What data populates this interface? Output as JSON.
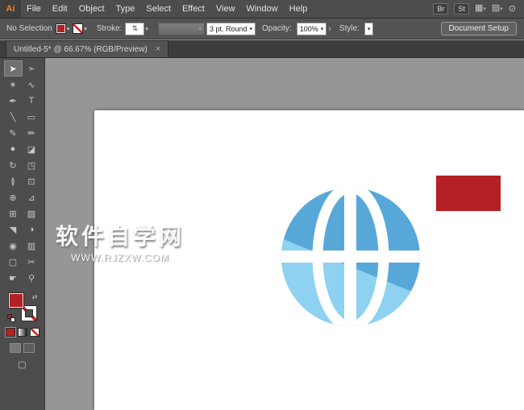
{
  "app": {
    "logo": "Ai"
  },
  "menu_bar": {
    "items": [
      "File",
      "Edit",
      "Object",
      "Type",
      "Select",
      "Effect",
      "View",
      "Window",
      "Help"
    ],
    "right": {
      "bridge": "Br",
      "stock": "St"
    }
  },
  "icons": {
    "dropdown": "▾",
    "spinner": "⇅",
    "chevron_right": "›",
    "arrange_documents": "▦",
    "workspace": "▤",
    "power": "⊙",
    "swap": "⇄",
    "close": "×",
    "screen_mode": "▢"
  },
  "control_bar": {
    "selection_label": "No Selection",
    "stroke_label": "Stroke:",
    "brush_value": "3 pt. Round",
    "opacity_label": "Opacity:",
    "opacity_value": "100%",
    "style_label": "Style:",
    "document_setup_label": "Document Setup"
  },
  "tab": {
    "title": "Untitled-5* @ 66.67% (RGB/Preview)"
  },
  "toolbar": {
    "tools": [
      {
        "name": "selection-tool",
        "glyph": "➤"
      },
      {
        "name": "direct-selection-tool",
        "glyph": "➣"
      },
      {
        "name": "magic-wand-tool",
        "glyph": "✶"
      },
      {
        "name": "lasso-tool",
        "glyph": "∿"
      },
      {
        "name": "pen-tool",
        "glyph": "✒"
      },
      {
        "name": "type-tool",
        "glyph": "T"
      },
      {
        "name": "line-segment-tool",
        "glyph": "╲"
      },
      {
        "name": "rectangle-tool",
        "glyph": "▭"
      },
      {
        "name": "paintbrush-tool",
        "glyph": "✎"
      },
      {
        "name": "pencil-tool",
        "glyph": "✏"
      },
      {
        "name": "blob-brush-tool",
        "glyph": "●"
      },
      {
        "name": "eraser-tool",
        "glyph": "◪"
      },
      {
        "name": "rotate-tool",
        "glyph": "↻"
      },
      {
        "name": "scale-tool",
        "glyph": "◳"
      },
      {
        "name": "width-tool",
        "glyph": "≬"
      },
      {
        "name": "free-transform-tool",
        "glyph": "⊡"
      },
      {
        "name": "shape-builder-tool",
        "glyph": "⊕"
      },
      {
        "name": "perspective-grid-tool",
        "glyph": "⊿"
      },
      {
        "name": "mesh-tool",
        "glyph": "⊞"
      },
      {
        "name": "gradient-tool",
        "glyph": "▨"
      },
      {
        "name": "eyedropper-tool",
        "glyph": "◥"
      },
      {
        "name": "blend-tool",
        "glyph": "◑"
      },
      {
        "name": "symbol-sprayer-tool",
        "glyph": "◉"
      },
      {
        "name": "column-graph-tool",
        "glyph": "▥"
      },
      {
        "name": "artboard-tool",
        "glyph": "▢"
      },
      {
        "name": "slice-tool",
        "glyph": "✂"
      },
      {
        "name": "hand-tool",
        "glyph": "☛"
      },
      {
        "name": "zoom-tool",
        "glyph": "⚲"
      }
    ]
  },
  "watermark": {
    "line1": "软件自学网",
    "line2": "WWW.RJZXW.COM"
  },
  "colors": {
    "fill_red": "#b32025",
    "globe_blue": "#57a8d8",
    "globe_light_blue": "#8ed1f0"
  }
}
